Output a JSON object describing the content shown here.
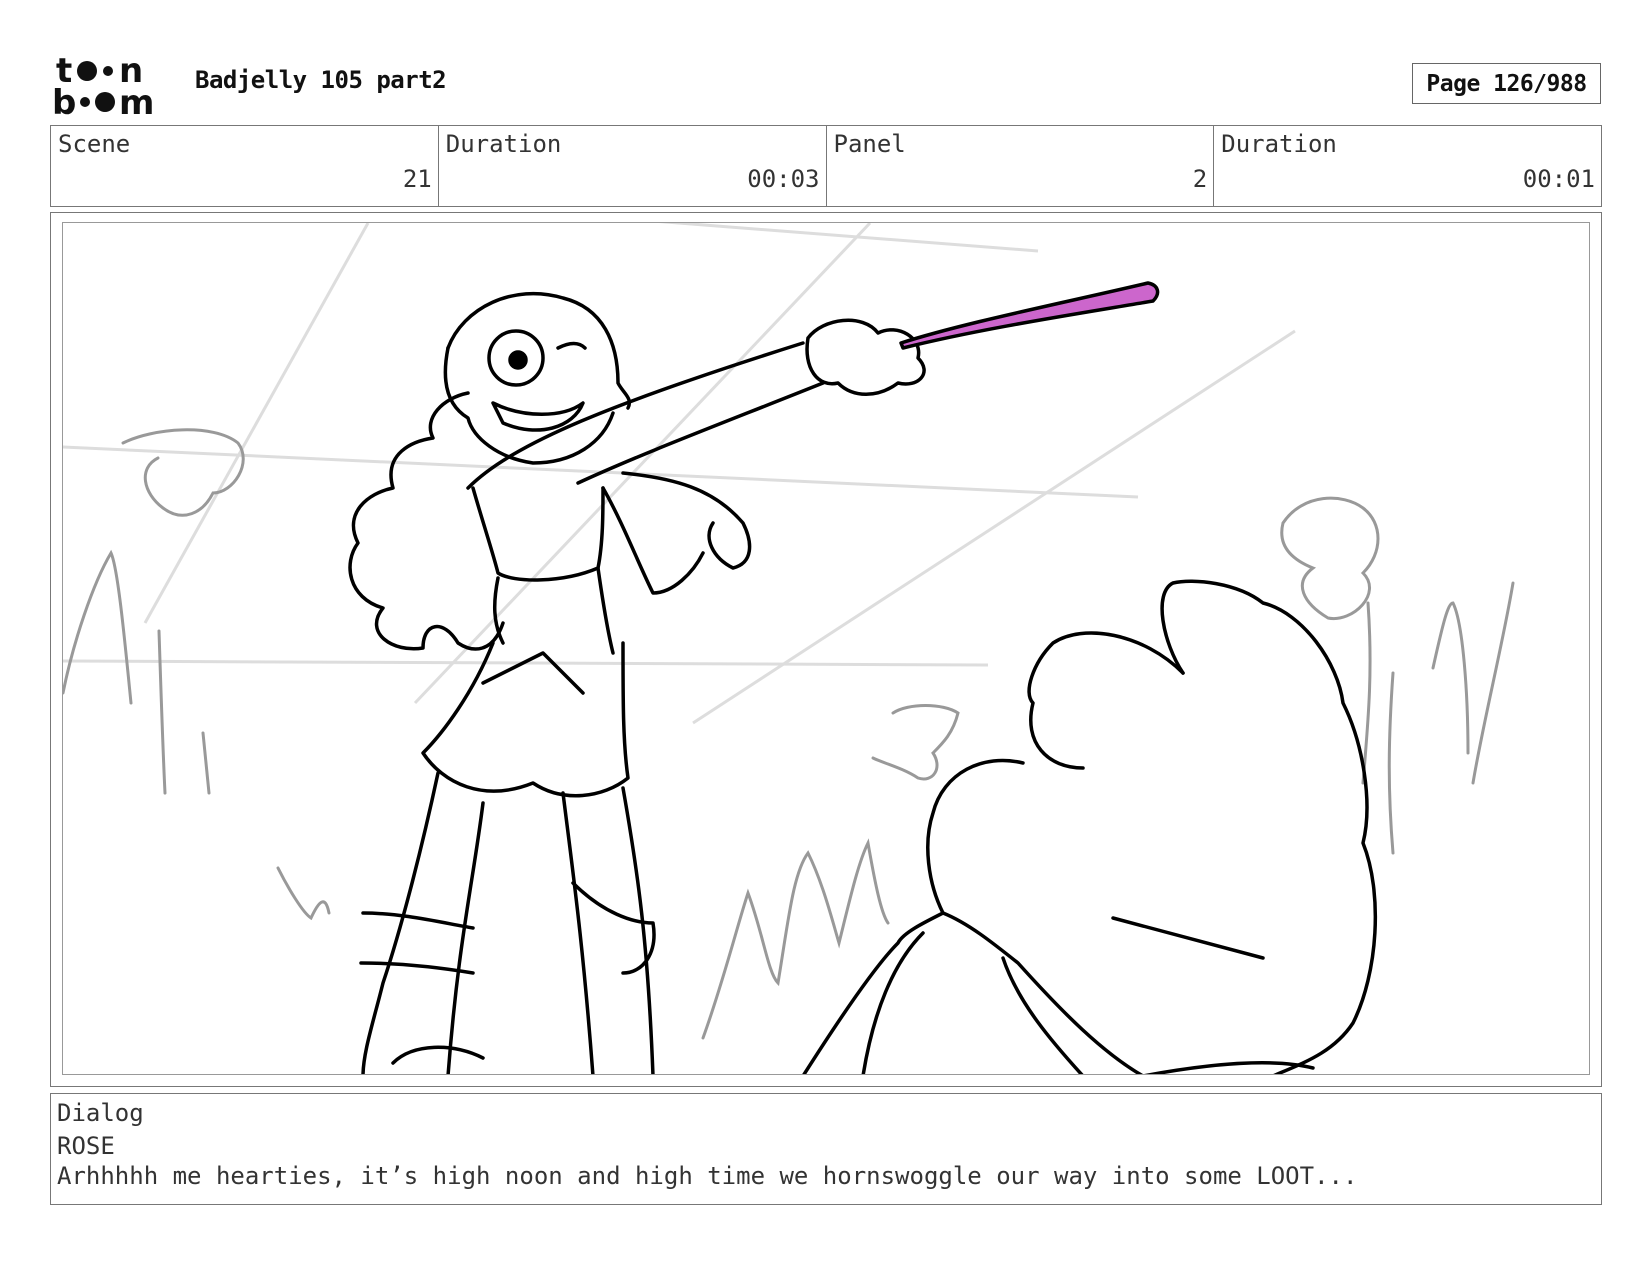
{
  "header": {
    "logo_text": "toon boom",
    "project_title": "Badjelly 105 part2",
    "page_label": "Page 126/988"
  },
  "info": {
    "scene_label": "Scene",
    "scene_value": "21",
    "scene_duration_label": "Duration",
    "scene_duration_value": "00:03",
    "panel_label": "Panel",
    "panel_value": "2",
    "panel_duration_label": "Duration",
    "panel_duration_value": "00:01"
  },
  "dialog": {
    "label": "Dialog",
    "speaker": "ROSE",
    "line": "Arhhhhh me hearties, it’s high noon and high time we hornswoggle our way into some LOOT..."
  },
  "colors": {
    "sword": "#cc66cc",
    "ink": "#000000",
    "background_sketch": "#999999",
    "perspective_guides": "#dddddd"
  }
}
